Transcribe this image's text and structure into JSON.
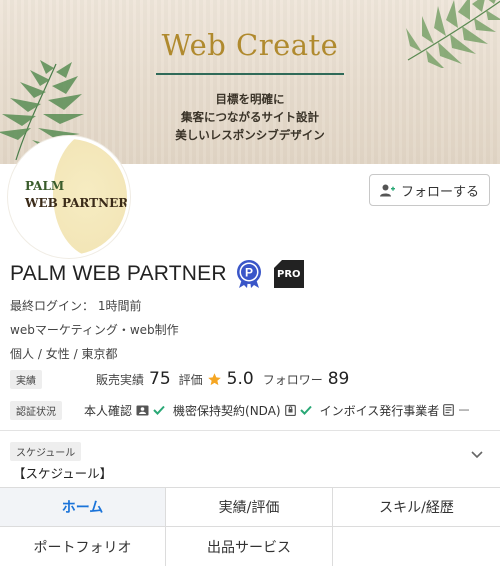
{
  "banner": {
    "title": "Web Create",
    "subtitle_lines": [
      "目標を明確に",
      "集客につながるサイト設計",
      "美しいレスポンシブデザイン"
    ]
  },
  "avatar": {
    "line1": "PALM",
    "line2": "WEB PARTNER"
  },
  "follow": {
    "label": "フォローする",
    "icon": "person-add-icon"
  },
  "profile": {
    "name": "PALM WEB PARTNER",
    "badges": [
      "platinum-p-badge",
      "pro-badge"
    ],
    "pro_label": "PRO",
    "last_login": "最終ログイン： 1時間前",
    "specialty": "webマーケティング・web制作",
    "attributes": [
      "個人",
      "女性",
      "東京都"
    ],
    "separator": "/"
  },
  "stats": {
    "tag": "実績",
    "sales_label": "販売実績",
    "sales_value": "75",
    "rating_label": "評価",
    "rating_value": "5.0",
    "followers_label": "フォロワー",
    "followers_value": "89"
  },
  "certification": {
    "tag": "認証状況",
    "items": [
      {
        "label": "本人確認",
        "icon": "id-card-icon",
        "status": "verified"
      },
      {
        "label": "機密保持契約(NDA)",
        "icon": "lock-document-icon",
        "status": "verified"
      },
      {
        "label": "インボイス発行事業者",
        "icon": "invoice-icon",
        "status": "none"
      }
    ]
  },
  "schedule": {
    "tag": "スケジュール",
    "text": "【スケジュール】"
  },
  "tabs": [
    {
      "label": "ホーム",
      "active": true
    },
    {
      "label": "実績/評価",
      "active": false
    },
    {
      "label": "スキル/経歴",
      "active": false
    },
    {
      "label": "ポートフォリオ",
      "active": false
    },
    {
      "label": "出品サービス",
      "active": false
    }
  ],
  "colors": {
    "accent": "#1a73d9",
    "check": "#2aa876",
    "star": "#f5a623",
    "banner_gold": "#b08a2e",
    "banner_rule": "#2f6a58"
  }
}
